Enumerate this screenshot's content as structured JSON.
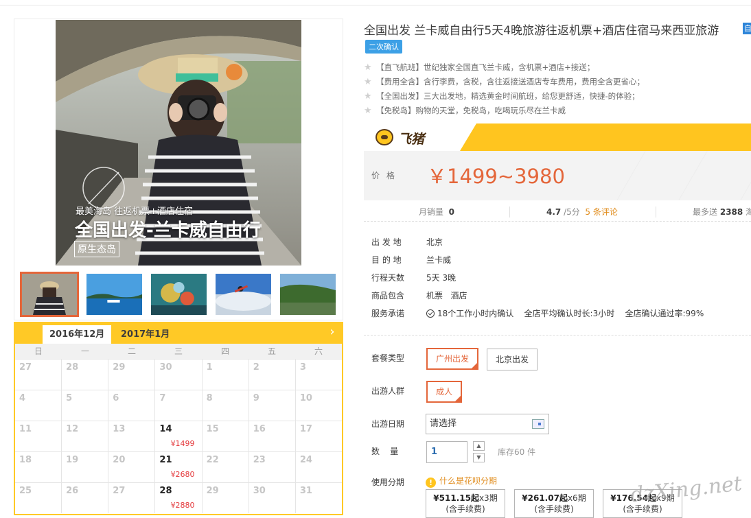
{
  "gallery": {
    "overlay_sub": "最美海岛 往返机票+酒店住宿",
    "overlay_title": "全国出发-兰卡威自由行",
    "overlay_tag": "原生态岛",
    "thumbs": [
      "thumb-1",
      "thumb-2",
      "thumb-3",
      "thumb-4",
      "thumb-5"
    ]
  },
  "calendar": {
    "tabs": [
      "2016年12月",
      "2017年1月"
    ],
    "next_icon": "chevron-right-icon",
    "weekdays": [
      "日",
      "一",
      "二",
      "三",
      "四",
      "五",
      "六"
    ],
    "weeks": [
      [
        {
          "d": "27"
        },
        {
          "d": "28"
        },
        {
          "d": "29"
        },
        {
          "d": "30"
        },
        {
          "d": "1"
        },
        {
          "d": "2"
        },
        {
          "d": "3"
        }
      ],
      [
        {
          "d": "4"
        },
        {
          "d": "5"
        },
        {
          "d": "6"
        },
        {
          "d": "7"
        },
        {
          "d": "8"
        },
        {
          "d": "9"
        },
        {
          "d": "10"
        }
      ],
      [
        {
          "d": "11"
        },
        {
          "d": "12"
        },
        {
          "d": "13"
        },
        {
          "d": "14",
          "price": "¥1499"
        },
        {
          "d": "15"
        },
        {
          "d": "16"
        },
        {
          "d": "17"
        }
      ],
      [
        {
          "d": "18"
        },
        {
          "d": "19"
        },
        {
          "d": "20"
        },
        {
          "d": "21",
          "price": "¥2680"
        },
        {
          "d": "22"
        },
        {
          "d": "23"
        },
        {
          "d": "24"
        }
      ],
      [
        {
          "d": "25"
        },
        {
          "d": "26"
        },
        {
          "d": "27"
        },
        {
          "d": "28",
          "price": "¥2880"
        },
        {
          "d": "29"
        },
        {
          "d": "30"
        },
        {
          "d": "31"
        }
      ]
    ]
  },
  "product": {
    "title": "全国出发 兰卡威自由行5天4晚旅游往返机票+酒店住宿马来西亚旅游",
    "title_badge": "自",
    "confirm_badge": "二次确认",
    "highlights": [
      "【直飞航班】世纪独家全国直飞兰卡威，含机票+酒店+接送；",
      "【费用全含】含行李费，含税，含往返接送酒店专车费用，费用全含更省心；",
      "【全国出发】三大出发地，精选黄金时间航班，给您更舒适，快捷-的体验；",
      "【免税岛】购物的天堂，免税岛，吃喝玩乐尽在兰卡威"
    ]
  },
  "price": {
    "brand": "飞猪",
    "label": "价格",
    "value": "￥1499~3980"
  },
  "stats": {
    "sales_label": "月销量",
    "sales_value": "0",
    "rating": "4.7",
    "rating_suffix": "/5分",
    "reviews": "5 条评论",
    "points_label": "最多送",
    "points_value": "2388",
    "points_suffix": "淘"
  },
  "props": [
    {
      "k": "出 发 地",
      "v": "北京"
    },
    {
      "k": "目 的 地",
      "v": "兰卡威"
    },
    {
      "k": "行程天数",
      "v": "5天 3晚"
    },
    {
      "k": "商品包含",
      "v": "机票   酒店"
    }
  ],
  "service": {
    "label": "服务承诺",
    "items": [
      "18个工作小时内确认",
      "全店平均确认时长:3小时",
      "全店确认通过率:99%"
    ]
  },
  "options": {
    "package_label": "套餐类型",
    "packages": [
      "广州出发",
      "北京出发"
    ],
    "group_label": "出游人群",
    "groups": [
      "成人"
    ],
    "date_label": "出游日期",
    "date_value": "请选择",
    "qty_label": "数    量",
    "qty_value": "1",
    "stock": "库存60 件",
    "inst_label": "使用分期",
    "huabei": "什么是花呗分期",
    "installments": [
      {
        "amount": "¥511.15起",
        "term": "x3期",
        "note": "(含手续费)"
      },
      {
        "amount": "¥261.07起",
        "term": "x6期",
        "note": "(含手续费)"
      },
      {
        "amount": "¥176.54起",
        "term": "x9期",
        "note": "(含手续费)"
      }
    ]
  },
  "watermark": "dzXing.net"
}
